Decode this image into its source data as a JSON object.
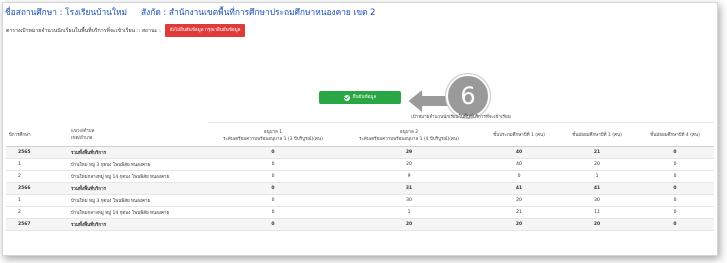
{
  "header": {
    "school_label": "ชื่อสถานศึกษา : โรงเรียนบ้านใหม่",
    "affiliation_label": "สังกัด : สำนักงานเขตพื้นที่การศึกษาประถมศึกษาหนองคาย เขต 2"
  },
  "subheader": {
    "text": "ตารางเป้าหมายจำนวนนักเรียนในพื้นที่บริการที่จะเข้าเรียน :: สถานะ :",
    "status_button": "ยังไม่ยืนยันข้อมูล กรุณายืนยันข้อมูล"
  },
  "confirm_button": {
    "label": "ยืนยันข้อมูล"
  },
  "step_badge": "6",
  "table": {
    "group_header": "เป้าหมายจำนวนนักเรียนในพื้นที่บริการที่จะเข้าเรียน",
    "columns": [
      {
        "line1": "ปีการศึกษา",
        "line2": ""
      },
      {
        "line1": "แขวง/ตำบล",
        "line2": "เขต/อำเภอ"
      },
      {
        "line1": "อนุบาล 1",
        "line2": "ระดับเตรียมความพร้อมอนุบาล 1 (3 ปีบริบูรณ์)(คน)"
      },
      {
        "line1": "อนุบาล 2",
        "line2": "ระดับเตรียมความพร้อมอนุบาล 1 (4 ปีบริบูรณ์)(คน)"
      },
      {
        "line1": "ชั้นประถมศึกษาปีที่ 1 (คน)",
        "line2": ""
      },
      {
        "line1": "ชั้นมัธยมศึกษาปีที่ 1 (คน)",
        "line2": ""
      },
      {
        "line1": "ชั้นมัธยมศึกษาปีที่ 4 (คน)",
        "line2": ""
      }
    ],
    "rows": [
      {
        "year": "2565",
        "area": "รวมทั้งพื้นที่บริการ",
        "k1": "0",
        "k2": "29",
        "p1": "40",
        "m1": "21",
        "m4": "0",
        "summary": true
      },
      {
        "year": "1",
        "area": "บ้านใหม่ หมู่ 3 กุดบง โพนพิสัย หนองคาย",
        "k1": "0",
        "k2": "20",
        "p1": "40",
        "m1": "20",
        "m4": "0",
        "summary": false
      },
      {
        "year": "2",
        "area": "บ้านใหม่กลางหมู่ หมู่ 14 กุดบง โพนพิสัย หนองคาย",
        "k1": "0",
        "k2": "9",
        "p1": "0",
        "m1": "1",
        "m4": "0",
        "summary": false
      },
      {
        "year": "2566",
        "area": "รวมทั้งพื้นที่บริการ",
        "k1": "0",
        "k2": "31",
        "p1": "41",
        "m1": "41",
        "m4": "0",
        "summary": true
      },
      {
        "year": "1",
        "area": "บ้านใหม่ หมู่ 3 กุดบง โพนพิสัย หนองคาย",
        "k1": "0",
        "k2": "30",
        "p1": "20",
        "m1": "30",
        "m4": "0",
        "summary": false
      },
      {
        "year": "2",
        "area": "บ้านใหม่กลางหมู่ หมู่ 14 กุดบง โพนพิสัย หนองคาย",
        "k1": "0",
        "k2": "1",
        "p1": "21",
        "m1": "11",
        "m4": "0",
        "summary": false
      },
      {
        "year": "2567",
        "area": "รวมทั้งพื้นที่บริการ",
        "k1": "0",
        "k2": "20",
        "p1": "20",
        "m1": "20",
        "m4": "0",
        "summary": true
      }
    ]
  },
  "colors": {
    "title": "#1a4fb5",
    "status_button": "#e03b3b",
    "confirm_button": "#2aa745",
    "badge": "#9a9a9a"
  },
  "icons": {
    "confirm": "check-circle-icon",
    "pointer": "arrow-left-icon"
  }
}
